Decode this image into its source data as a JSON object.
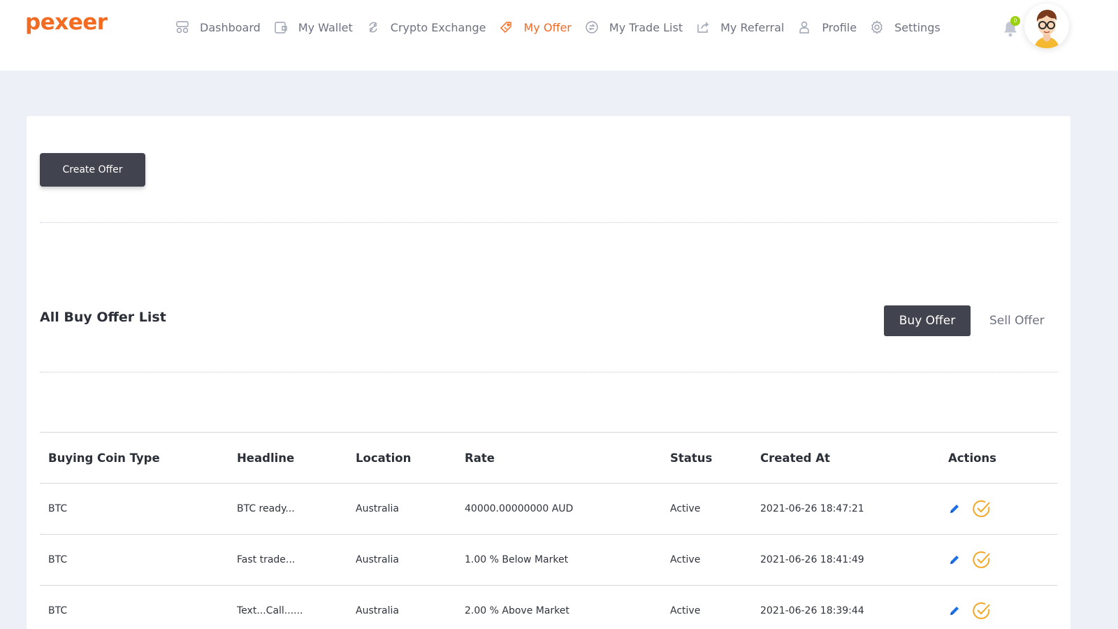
{
  "brand": {
    "name": "pexeer",
    "color": "#f26b21"
  },
  "nav": [
    {
      "label": "Dashboard",
      "icon": "dashboard-icon",
      "active": false
    },
    {
      "label": "My Wallet",
      "icon": "wallet-icon",
      "active": false
    },
    {
      "label": "Crypto Exchange",
      "icon": "exchange-icon",
      "active": false
    },
    {
      "label": "My Offer",
      "icon": "offer-tag-icon",
      "active": true
    },
    {
      "label": "My Trade List",
      "icon": "trade-list-icon",
      "active": false
    },
    {
      "label": "My Referral",
      "icon": "referral-share-icon",
      "active": false
    },
    {
      "label": "Profile",
      "icon": "user-icon",
      "active": false
    },
    {
      "label": "Settings",
      "icon": "gear-icon",
      "active": false
    }
  ],
  "notifications": {
    "count": "0",
    "badge_color": "#9bd00f"
  },
  "actions": {
    "create_offer": "Create Offer"
  },
  "offer_list": {
    "title": "All Buy Offer List",
    "tabs": [
      {
        "label": "Buy Offer",
        "active": true
      },
      {
        "label": "Sell Offer",
        "active": false
      }
    ],
    "columns": [
      "Buying Coin Type",
      "Headline",
      "Location",
      "Rate",
      "Status",
      "Created At",
      "Actions"
    ],
    "rows": [
      {
        "coin": "BTC",
        "headline": "BTC ready...",
        "location": "Australia",
        "rate": "40000.00000000 AUD",
        "status": "Active",
        "created_at": "2021-06-26 18:47:21"
      },
      {
        "coin": "BTC",
        "headline": "Fast trade...",
        "location": "Australia",
        "rate": "1.00 % Below Market",
        "status": "Active",
        "created_at": "2021-06-26 18:41:49"
      },
      {
        "coin": "BTC",
        "headline": "Text...Call......",
        "location": "Australia",
        "rate": "2.00 % Above Market",
        "status": "Active",
        "created_at": "2021-06-26 18:39:44"
      }
    ]
  },
  "colors": {
    "accent": "#f26b21",
    "dark_button": "#41444f",
    "edit_icon": "#1f6fe5",
    "page_bg": "#eef0f7"
  }
}
